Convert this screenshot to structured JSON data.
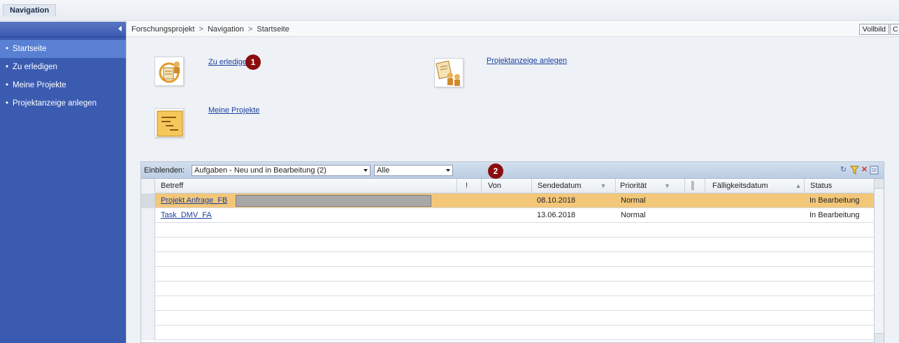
{
  "top_tab": {
    "label": "Navigation"
  },
  "sidebar": {
    "items": [
      {
        "label": "Startseite",
        "bullet": "•"
      },
      {
        "label": "Zu erledigen",
        "bullet": "•"
      },
      {
        "label": "Meine Projekte",
        "bullet": "•"
      },
      {
        "label": "Projektanzeige anlegen",
        "bullet": "•"
      }
    ]
  },
  "breadcrumb": {
    "items": [
      "Forschungsprojekt",
      "Navigation",
      "Startseite"
    ],
    "separator": ">"
  },
  "header_buttons": {
    "vollbild": "Vollbild",
    "extra": "C"
  },
  "tiles": {
    "todo_link": "Zu erledigen",
    "projects_link": "Meine Projekte",
    "create_link": "Projektanzeige anlegen"
  },
  "badges": {
    "one": "1",
    "two": "2"
  },
  "filter": {
    "label": "Einblenden:",
    "tasks_select": "Aufgaben - Neu und in Bearbeitung  (2)",
    "scope_select": "Alle"
  },
  "grid": {
    "columns": {
      "betreff": "Betreff",
      "excl": "!",
      "von": "Von",
      "sendedatum": "Sendedatum",
      "prioritaet": "Priorität",
      "faelligkeitsdatum": "Fälligkeitsdatum",
      "status": "Status"
    },
    "rows": [
      {
        "betreff": "Projekt Anfrage_FB",
        "von": "",
        "sendedatum": "08.10.2018",
        "prioritaet": "Normal",
        "faelligkeitsdatum": "",
        "status": "In Bearbeitung"
      },
      {
        "betreff": "Task_DMV_FA",
        "von": "",
        "sendedatum": "13.06.2018",
        "prioritaet": "Normal",
        "faelligkeitsdatum": "",
        "status": "In Bearbeitung"
      }
    ]
  },
  "colors": {
    "sidebar_bg": "#3a5bb0",
    "sidebar_active": "#5a80d4",
    "selected_row": "#f3c779",
    "badge": "#8b0e0e",
    "link": "#1a3fa0"
  }
}
